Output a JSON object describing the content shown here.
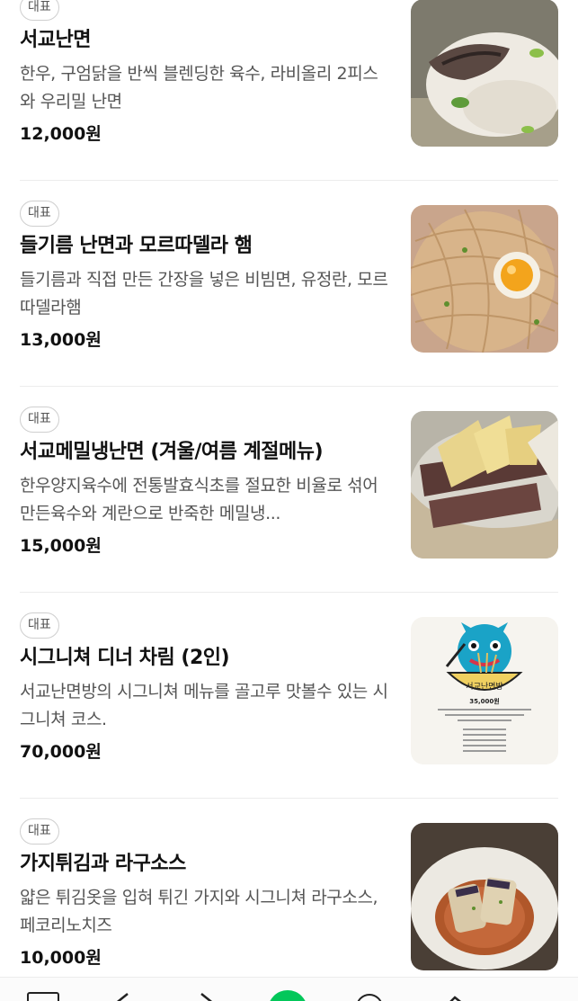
{
  "menu": {
    "items": [
      {
        "badge": "대표",
        "name": "서교난면",
        "description": "한우, 구엄닭을 반씩 블렌딩한 육수, 라비올리 2피스와 우리밀 난면",
        "price": "12,000원",
        "image": "dumpling-noodle-photo"
      },
      {
        "badge": "대표",
        "name": "들기름 난면과 모르따델라 햄",
        "description": "들기름과 직접 만든 간장을 넣은 비빔면, 유정란, 모르따델라햄",
        "price": "13,000원",
        "image": "perilla-oil-noodle-photo"
      },
      {
        "badge": "대표",
        "name": "서교메밀냉난면 (겨울/여름 계절메뉴)",
        "description": "한우양지육수에 전통발효식초를 절묘한 비율로 섞어 만든육수와 계란으로 반죽한 메밀냉...",
        "price": "15,000원",
        "image": "cold-buckwheat-noodle-photo"
      },
      {
        "badge": "대표",
        "name": "시그니쳐 디너 차림 (2인)",
        "description": "서교난면방의 시그니쳐 메뉴를 골고루 맛볼수 있는 시그니쳐 코스.",
        "price": "70,000원",
        "image": "signature-course-poster",
        "poster_title": "서교난면방",
        "poster_price": "35,000원"
      },
      {
        "badge": "대표",
        "name": "가지튀김과 라구소스",
        "description": "얇은 튀김옷을 입혀 튀긴 가지와 시그니쳐 라구소스, 페코리노치즈",
        "price": "10,000원",
        "image": "fried-eggplant-photo"
      }
    ]
  },
  "bottom_nav": {
    "icons": [
      "menu-icon",
      "back-icon",
      "forward-icon",
      "home-icon",
      "search-icon",
      "share-icon"
    ],
    "accent": "#03c75a"
  }
}
